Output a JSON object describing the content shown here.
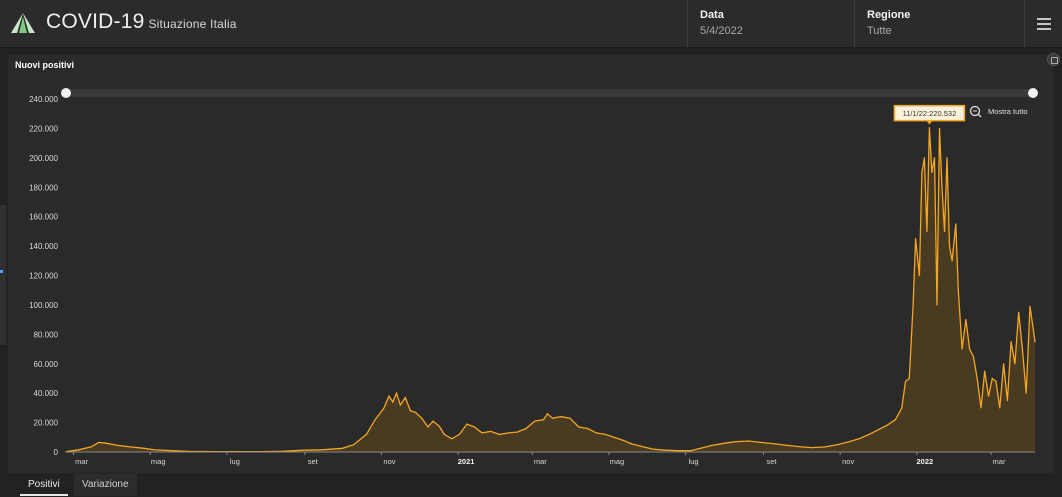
{
  "header": {
    "title": "COVID-19",
    "subtitle": "Situazione Italia",
    "date_label": "Data",
    "date_value": "5/4/2022",
    "region_label": "Regione",
    "region_value": "Tutte"
  },
  "panel": {
    "title": "Nuovi positivi"
  },
  "tooltip": {
    "text": "11/1/22:220.532"
  },
  "zoom": {
    "show_all_label": "Mostra tutto"
  },
  "tabs": [
    {
      "label": "Positivi",
      "active": true
    },
    {
      "label": "Variazione",
      "active": false
    }
  ],
  "colors": {
    "accent": "#f5a623",
    "background": "#222222",
    "panel": "#2a2a2a",
    "area_fill": "#4a3c22"
  },
  "chart_data": {
    "type": "area",
    "title": "Nuovi positivi",
    "ylim": [
      0,
      240000
    ],
    "yticks": [
      "240.000",
      "220.000",
      "200.000",
      "180.000",
      "160.000",
      "140.000",
      "120.000",
      "100.000",
      "80.000",
      "60.000",
      "40.000",
      "20.000",
      "0"
    ],
    "yticks_values": [
      240000,
      220000,
      200000,
      180000,
      160000,
      140000,
      120000,
      100000,
      80000,
      60000,
      40000,
      20000,
      0
    ],
    "xticks": [
      {
        "label": "mar",
        "date": "2020-03-01",
        "bold": false
      },
      {
        "label": "mag",
        "date": "2020-05-01",
        "bold": false
      },
      {
        "label": "lug",
        "date": "2020-07-01",
        "bold": false
      },
      {
        "label": "set",
        "date": "2020-09-01",
        "bold": false
      },
      {
        "label": "nov",
        "date": "2020-11-01",
        "bold": false
      },
      {
        "label": "2021",
        "date": "2021-01-01",
        "bold": true
      },
      {
        "label": "mar",
        "date": "2021-03-01",
        "bold": false
      },
      {
        "label": "mag",
        "date": "2021-05-01",
        "bold": false
      },
      {
        "label": "lug",
        "date": "2021-07-01",
        "bold": false
      },
      {
        "label": "set",
        "date": "2021-09-01",
        "bold": false
      },
      {
        "label": "nov",
        "date": "2021-11-01",
        "bold": false
      },
      {
        "label": "2022",
        "date": "2022-01-01",
        "bold": true
      },
      {
        "label": "mar",
        "date": "2022-03-01",
        "bold": false
      }
    ],
    "xlim": [
      "2020-02-24",
      "2022-04-05"
    ],
    "grid": false,
    "series": [
      {
        "values": [
          [
            "2020-02-24",
            200
          ],
          [
            "2020-03-05",
            1500
          ],
          [
            "2020-03-15",
            3500
          ],
          [
            "2020-03-21",
            6500
          ],
          [
            "2020-03-27",
            6000
          ],
          [
            "2020-04-05",
            4500
          ],
          [
            "2020-04-15",
            3500
          ],
          [
            "2020-04-25",
            2600
          ],
          [
            "2020-05-05",
            1400
          ],
          [
            "2020-05-20",
            800
          ],
          [
            "2020-06-01",
            400
          ],
          [
            "2020-06-20",
            250
          ],
          [
            "2020-07-10",
            200
          ],
          [
            "2020-07-31",
            300
          ],
          [
            "2020-08-15",
            500
          ],
          [
            "2020-08-31",
            1200
          ],
          [
            "2020-09-15",
            1500
          ],
          [
            "2020-10-01",
            2500
          ],
          [
            "2020-10-10",
            5000
          ],
          [
            "2020-10-20",
            12000
          ],
          [
            "2020-10-27",
            22000
          ],
          [
            "2020-11-03",
            30000
          ],
          [
            "2020-11-07",
            38000
          ],
          [
            "2020-11-10",
            34000
          ],
          [
            "2020-11-13",
            40000
          ],
          [
            "2020-11-16",
            32000
          ],
          [
            "2020-11-20",
            37000
          ],
          [
            "2020-11-24",
            28000
          ],
          [
            "2020-11-28",
            27000
          ],
          [
            "2020-12-03",
            23000
          ],
          [
            "2020-12-08",
            17000
          ],
          [
            "2020-12-12",
            21000
          ],
          [
            "2020-12-17",
            17500
          ],
          [
            "2020-12-21",
            12000
          ],
          [
            "2020-12-27",
            9000
          ],
          [
            "2021-01-02",
            12000
          ],
          [
            "2021-01-08",
            19000
          ],
          [
            "2021-01-14",
            17000
          ],
          [
            "2021-01-20",
            13000
          ],
          [
            "2021-01-27",
            14000
          ],
          [
            "2021-02-03",
            12000
          ],
          [
            "2021-02-10",
            13000
          ],
          [
            "2021-02-17",
            13500
          ],
          [
            "2021-02-24",
            16000
          ],
          [
            "2021-03-03",
            21000
          ],
          [
            "2021-03-10",
            22000
          ],
          [
            "2021-03-13",
            26000
          ],
          [
            "2021-03-17",
            23000
          ],
          [
            "2021-03-24",
            24000
          ],
          [
            "2021-03-31",
            23000
          ],
          [
            "2021-04-07",
            17000
          ],
          [
            "2021-04-14",
            16000
          ],
          [
            "2021-04-21",
            13000
          ],
          [
            "2021-04-28",
            12000
          ],
          [
            "2021-05-05",
            10000
          ],
          [
            "2021-05-12",
            8000
          ],
          [
            "2021-05-19",
            5500
          ],
          [
            "2021-05-26",
            4000
          ],
          [
            "2021-06-05",
            2000
          ],
          [
            "2021-06-15",
            1200
          ],
          [
            "2021-06-25",
            900
          ],
          [
            "2021-07-05",
            900
          ],
          [
            "2021-07-15",
            3000
          ],
          [
            "2021-07-22",
            4500
          ],
          [
            "2021-08-01",
            6000
          ],
          [
            "2021-08-10",
            7000
          ],
          [
            "2021-08-20",
            7500
          ],
          [
            "2021-08-30",
            6500
          ],
          [
            "2021-09-10",
            5500
          ],
          [
            "2021-09-20",
            4500
          ],
          [
            "2021-10-01",
            3500
          ],
          [
            "2021-10-10",
            3000
          ],
          [
            "2021-10-20",
            3500
          ],
          [
            "2021-10-30",
            5000
          ],
          [
            "2021-11-08",
            7000
          ],
          [
            "2021-11-16",
            9000
          ],
          [
            "2021-11-24",
            12000
          ],
          [
            "2021-12-01",
            15000
          ],
          [
            "2021-12-08",
            18000
          ],
          [
            "2021-12-15",
            22000
          ],
          [
            "2021-12-20",
            30000
          ],
          [
            "2021-12-23",
            48000
          ],
          [
            "2021-12-26",
            50000
          ],
          [
            "2021-12-29",
            100000
          ],
          [
            "2021-12-31",
            145000
          ],
          [
            "2022-01-03",
            120000
          ],
          [
            "2022-01-05",
            190000
          ],
          [
            "2022-01-07",
            200000
          ],
          [
            "2022-01-09",
            150000
          ],
          [
            "2022-01-11",
            220532
          ],
          [
            "2022-01-13",
            190000
          ],
          [
            "2022-01-15",
            200000
          ],
          [
            "2022-01-17",
            100000
          ],
          [
            "2022-01-19",
            220000
          ],
          [
            "2022-01-21",
            180000
          ],
          [
            "2022-01-23",
            150000
          ],
          [
            "2022-01-25",
            200000
          ],
          [
            "2022-01-27",
            140000
          ],
          [
            "2022-01-29",
            130000
          ],
          [
            "2022-02-01",
            155000
          ],
          [
            "2022-02-03",
            110000
          ],
          [
            "2022-02-06",
            70000
          ],
          [
            "2022-02-09",
            90000
          ],
          [
            "2022-02-12",
            70000
          ],
          [
            "2022-02-15",
            65000
          ],
          [
            "2022-02-18",
            50000
          ],
          [
            "2022-02-21",
            30000
          ],
          [
            "2022-02-24",
            55000
          ],
          [
            "2022-02-27",
            38000
          ],
          [
            "2022-03-02",
            50000
          ],
          [
            "2022-03-05",
            48000
          ],
          [
            "2022-03-08",
            30000
          ],
          [
            "2022-03-11",
            60000
          ],
          [
            "2022-03-14",
            35000
          ],
          [
            "2022-03-17",
            75000
          ],
          [
            "2022-03-20",
            60000
          ],
          [
            "2022-03-23",
            95000
          ],
          [
            "2022-03-26",
            70000
          ],
          [
            "2022-03-29",
            40000
          ],
          [
            "2022-04-01",
            99000
          ],
          [
            "2022-04-05",
            75000
          ]
        ]
      }
    ]
  }
}
